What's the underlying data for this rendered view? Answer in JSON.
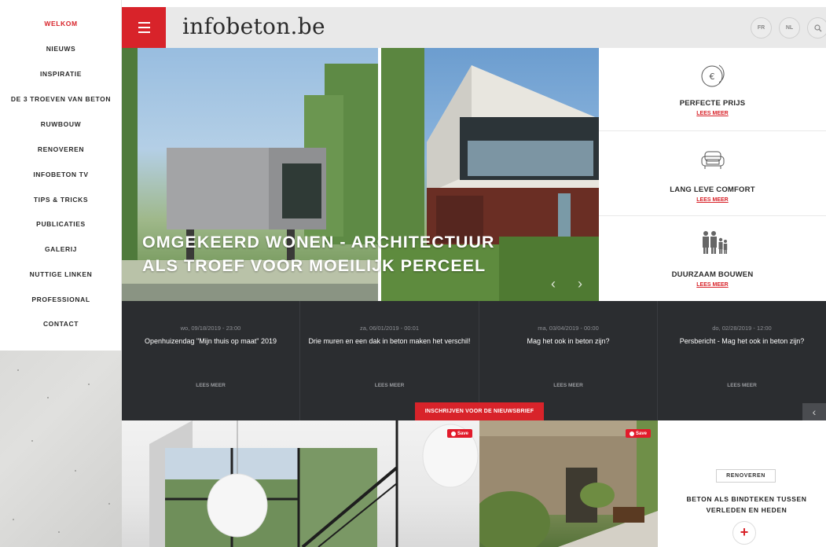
{
  "sidebar": {
    "items": [
      {
        "label": "WELKOM",
        "active": true
      },
      {
        "label": "NIEUWS"
      },
      {
        "label": "INSPIRATIE"
      },
      {
        "label": "DE 3 TROEVEN VAN BETON"
      },
      {
        "label": "RUWBOUW"
      },
      {
        "label": "RENOVEREN"
      },
      {
        "label": "INFOBETON TV"
      },
      {
        "label": "TIPS & TRICKS"
      },
      {
        "label": "PUBLICATIES"
      },
      {
        "label": "GALERIJ"
      },
      {
        "label": "NUTTIGE LINKEN"
      },
      {
        "label": "PROFESSIONAL"
      },
      {
        "label": "CONTACT"
      }
    ]
  },
  "header": {
    "logo": "infobeton.be",
    "lang_fr": "FR",
    "lang_nl": "NL"
  },
  "hero": {
    "title_line1": "OMGEKEERD WONEN - ARCHITECTUUR",
    "title_line2": "ALS TROEF VOOR MOEILIJK PERCEEL",
    "prev": "‹",
    "next": "›"
  },
  "features": [
    {
      "title": "PERFECTE PRIJS",
      "link": "LEES MEER",
      "icon": "euro-coin-icon"
    },
    {
      "title": "LANG LEVE COMFORT",
      "link": "LEES MEER",
      "icon": "armchair-icon"
    },
    {
      "title": "DUURZAAM BOUWEN",
      "link": "LEES MEER",
      "icon": "family-icon"
    }
  ],
  "news": {
    "items": [
      {
        "date": "wo, 09/18/2019 - 23:00",
        "title": "Openhuizendag \"Mijn thuis op maat\" 2019",
        "more": "LEES MEER"
      },
      {
        "date": "za, 06/01/2019 - 00:01",
        "title": "Drie muren en een dak in beton maken het verschil!",
        "more": "LEES MEER"
      },
      {
        "date": "ma, 03/04/2019 - 00:00",
        "title": "Mag het ook in beton zijn?",
        "more": "LEES MEER"
      },
      {
        "date": "do, 02/28/2019 - 12:00",
        "title": "Persbericht - Mag het ook in beton zijn?",
        "more": "LEES MEER"
      }
    ],
    "prev": "‹"
  },
  "newsletter": {
    "label": "INSCHRIJVEN VOOR DE NIEUWSBRIEF"
  },
  "gallery": {
    "save_label": "Save"
  },
  "card": {
    "tag": "RENOVEREN",
    "title": "BETON ALS BINDTEKEN TUSSEN VERLEDEN EN HEDEN",
    "plus": "+"
  },
  "colors": {
    "accent": "#d8232a",
    "dark_strip": "#2b2d30",
    "header_bg": "#e9e9e9"
  }
}
